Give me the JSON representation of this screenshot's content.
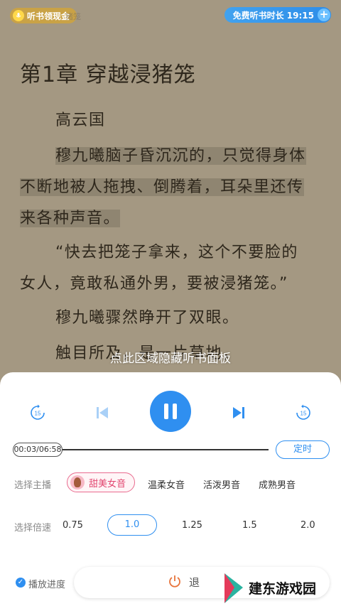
{
  "header": {
    "earn_chip": "听书领现金",
    "ghost_text": "猪笼",
    "free_time": "免费听书时长 19:15",
    "plus": "+"
  },
  "chapter": {
    "title": "第1章  穿越浸猪笼",
    "p1": "高云国",
    "p2a": "穆九曦脑子昏沉沉的，只觉得身体",
    "p2b": "不断地被人拖拽、倒腾着，耳朵里还传",
    "p2c": "来各种声音。",
    "p3a": "“快去把笼子拿来，这个不要脸的",
    "p3b": "女人，竟敢私通外男，要被浸猪笼。”",
    "p4": "穆九曦骤然睁开了双眼。",
    "p5": "触目所及，是一片草地，"
  },
  "overlay_tip": "点此区域隐藏听书面板",
  "player": {
    "rewind_label": "15",
    "forward_label": "15",
    "time": "00:03/06:58",
    "progress": 0.007,
    "timer_label": "定时",
    "voice_label": "选择主播",
    "voices": [
      "甜美女音",
      "温柔女音",
      "活泼男音",
      "成熟男音"
    ],
    "selected_voice": "甜美女音",
    "speed_label": "选择倍速",
    "speeds": [
      "0.75",
      "1.0",
      "1.25",
      "1.5",
      "2.0"
    ],
    "selected_speed": "1.0",
    "progress_check_label": "播放进度",
    "exit_label": "退"
  },
  "watermark": {
    "text": "建东游戏园"
  },
  "colors": {
    "accent": "#2f8ff0",
    "reader_bg": "#a49882",
    "pink": "#e96b8f"
  }
}
